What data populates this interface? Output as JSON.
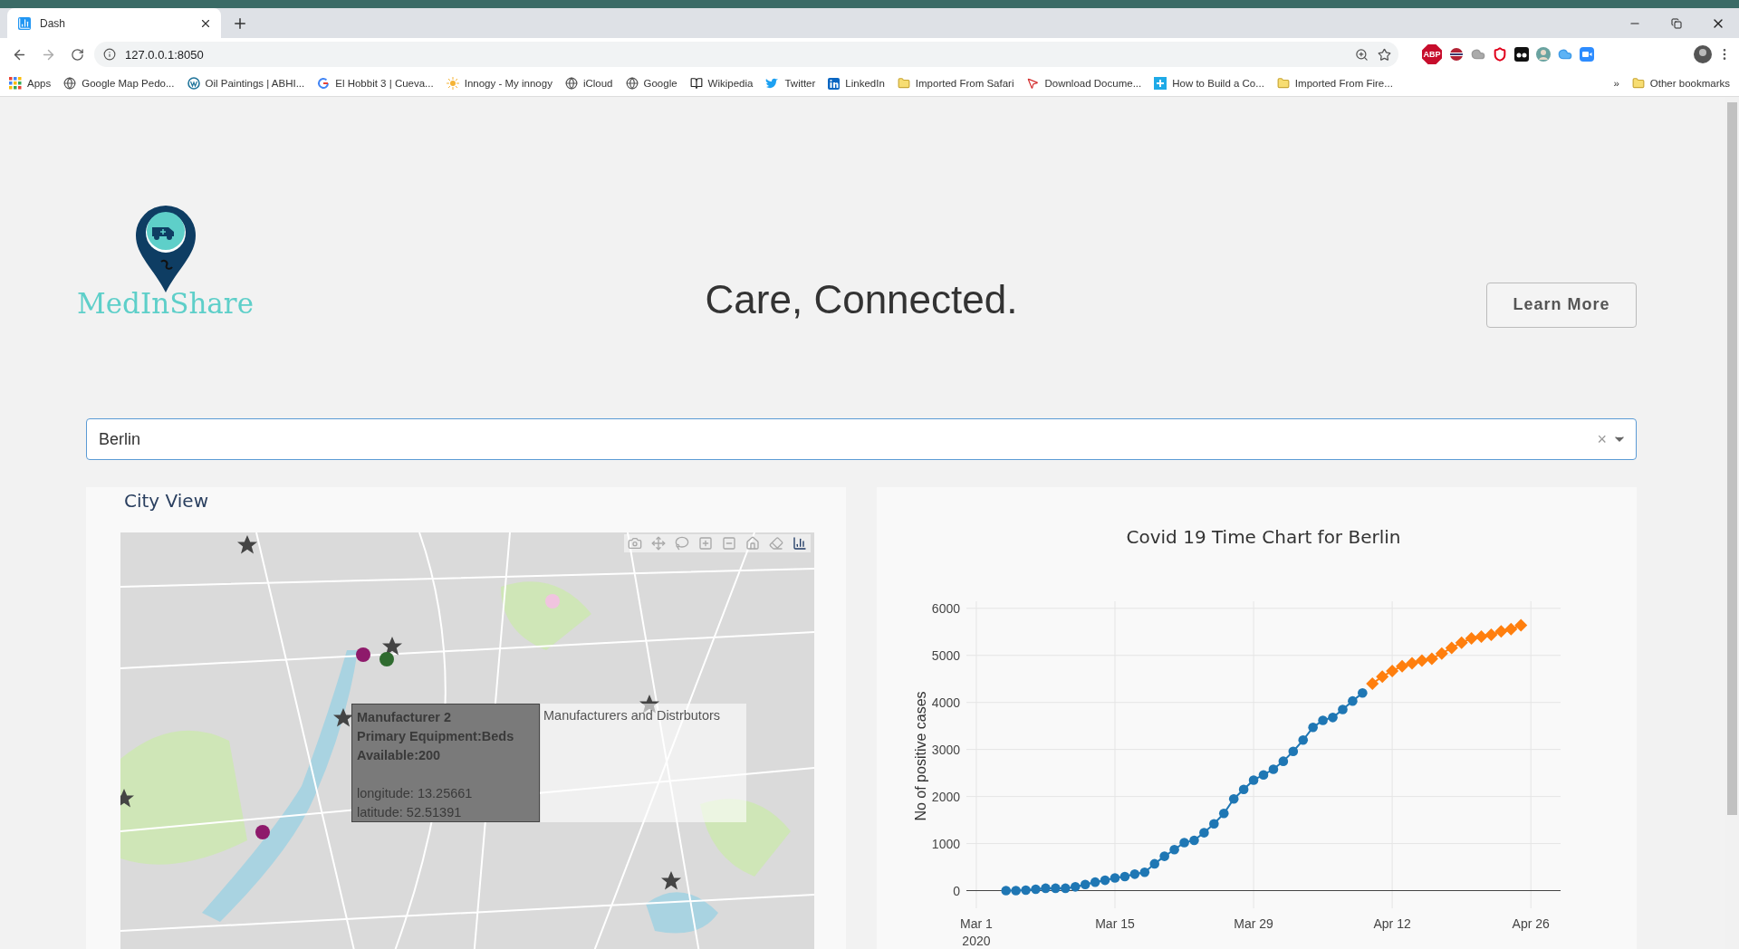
{
  "browser": {
    "tabs": [
      {
        "title": "Dash",
        "selected": true
      }
    ],
    "address": "127.0.0.1:8050",
    "bookmarks": [
      {
        "label": "Apps",
        "kind": "apps"
      },
      {
        "label": "Google Map Pedo...",
        "kind": "globe"
      },
      {
        "label": "Oil Paintings | ABHI...",
        "kind": "wordpress"
      },
      {
        "label": "El Hobbit 3 | Cueva...",
        "kind": "google"
      },
      {
        "label": "Innogy - My innogy",
        "kind": "sun"
      },
      {
        "label": "iCloud",
        "kind": "globe"
      },
      {
        "label": "Google",
        "kind": "globe"
      },
      {
        "label": "Wikipedia",
        "kind": "book"
      },
      {
        "label": "Twitter",
        "kind": "bird"
      },
      {
        "label": "LinkedIn",
        "kind": "linkedin"
      },
      {
        "label": "Imported From Safari",
        "kind": "folder"
      },
      {
        "label": "Download Docume...",
        "kind": "cursor"
      },
      {
        "label": "How to Build a Co...",
        "kind": "plus"
      },
      {
        "label": "Imported From Fire...",
        "kind": "folder"
      }
    ],
    "overflow": "»",
    "other_bookmarks": "Other bookmarks",
    "extensions": [
      {
        "kind": "abp",
        "label": "ABP"
      },
      {
        "kind": "flag"
      },
      {
        "kind": "cloud"
      },
      {
        "kind": "shield"
      },
      {
        "kind": "mask"
      },
      {
        "kind": "avatar"
      },
      {
        "kind": "icloud"
      },
      {
        "kind": "video"
      }
    ]
  },
  "header": {
    "logo_text": "MedInShare",
    "tagline": "Care, Connected.",
    "button": "Learn More"
  },
  "city_select": {
    "value": "Berlin",
    "clear": "×"
  },
  "city_view": {
    "title": "City View",
    "tooltip": {
      "lines": [
        {
          "text": "Manufacturer 2",
          "bold": true
        },
        {
          "text": "Primary Equipment:Beds",
          "bold": true
        },
        {
          "text": "Available:200",
          "bold": true
        },
        {
          "text": "longitude: 13.25661",
          "bold": false
        },
        {
          "text": "latitude: 52.51391",
          "bold": false
        }
      ]
    },
    "legend": "Manufacturers and Distrbutors"
  },
  "time_chart": {
    "chart_data": {
      "type": "line",
      "title": "Covid 19 Time Chart for Berlin",
      "ylabel": "No of positive cases",
      "grid": true,
      "x": [
        "2020-03-04",
        "2020-03-05",
        "2020-03-06",
        "2020-03-07",
        "2020-03-08",
        "2020-03-09",
        "2020-03-10",
        "2020-03-11",
        "2020-03-12",
        "2020-03-13",
        "2020-03-14",
        "2020-03-15",
        "2020-03-16",
        "2020-03-17",
        "2020-03-18",
        "2020-03-19",
        "2020-03-20",
        "2020-03-21",
        "2020-03-22",
        "2020-03-23",
        "2020-03-24",
        "2020-03-25",
        "2020-03-26",
        "2020-03-27",
        "2020-03-28",
        "2020-03-29",
        "2020-03-30",
        "2020-03-31",
        "2020-04-01",
        "2020-04-02",
        "2020-04-03",
        "2020-04-04",
        "2020-04-05",
        "2020-04-06",
        "2020-04-07",
        "2020-04-08",
        "2020-04-09",
        "2020-04-10",
        "2020-04-11",
        "2020-04-12",
        "2020-04-13",
        "2020-04-14",
        "2020-04-15",
        "2020-04-16",
        "2020-04-17",
        "2020-04-18",
        "2020-04-19",
        "2020-04-20",
        "2020-04-21",
        "2020-04-22",
        "2020-04-23",
        "2020-04-24",
        "2020-04-25"
      ],
      "series": [
        {
          "color": "#1f77b4",
          "marker": "circle",
          "values": [
            0,
            0,
            10,
            30,
            50,
            50,
            50,
            80,
            130,
            180,
            220,
            270,
            300,
            350,
            390,
            570,
            730,
            870,
            1020,
            1070,
            1230,
            1420,
            1640,
            1950,
            2150,
            2350,
            2460,
            2580,
            2750,
            2960,
            3200,
            3470,
            3620,
            3680,
            3850,
            4030,
            4200,
            null,
            null,
            null,
            null,
            null,
            null,
            null,
            null,
            null,
            null,
            null,
            null,
            null,
            null,
            null,
            null
          ]
        },
        {
          "color": "#ff7f0e",
          "marker": "diamond",
          "values": [
            null,
            null,
            null,
            null,
            null,
            null,
            null,
            null,
            null,
            null,
            null,
            null,
            null,
            null,
            null,
            null,
            null,
            null,
            null,
            null,
            null,
            null,
            null,
            null,
            null,
            null,
            null,
            null,
            null,
            null,
            null,
            null,
            null,
            null,
            null,
            null,
            null,
            4400,
            4550,
            4670,
            4770,
            4830,
            4890,
            4930,
            5040,
            5160,
            5270,
            5360,
            5400,
            5440,
            5510,
            5560,
            5640
          ]
        }
      ],
      "xlim": [
        "2020-02-29",
        "2020-04-29"
      ],
      "ylim": [
        -375,
        6150
      ],
      "xticks": [
        {
          "value": "2020-03-01",
          "label": "Mar 1\n2020"
        },
        {
          "value": "2020-03-15",
          "label": "Mar 15"
        },
        {
          "value": "2020-03-29",
          "label": "Mar 29"
        },
        {
          "value": "2020-04-12",
          "label": "Apr 12"
        },
        {
          "value": "2020-04-26",
          "label": "Apr 26"
        }
      ],
      "yticks": [
        0,
        1000,
        2000,
        3000,
        4000,
        5000,
        6000
      ]
    }
  }
}
